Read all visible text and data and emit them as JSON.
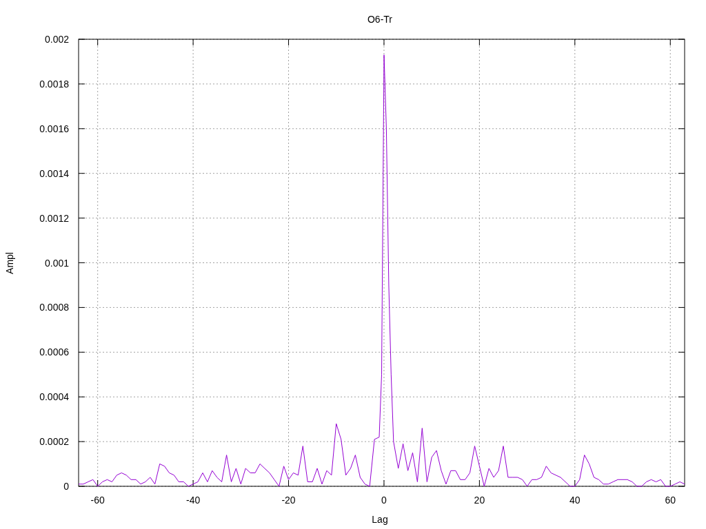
{
  "chart_data": {
    "type": "line",
    "grid": true,
    "title": "O6-Tr",
    "xlabel": "Lag",
    "ylabel": "Ampl",
    "xlim": [
      -64,
      63
    ],
    "ylim": [
      0,
      0.002
    ],
    "xticks": [
      -60,
      -40,
      -20,
      0,
      20,
      40,
      60
    ],
    "yticks": [
      0,
      0.0002,
      0.0004,
      0.0006,
      0.0008,
      0.001,
      0.0012,
      0.0014,
      0.0016,
      0.0018,
      0.002
    ],
    "x": [
      -64,
      -63,
      -62,
      -61,
      -60,
      -59,
      -58,
      -57,
      -56,
      -55,
      -54,
      -53,
      -52,
      -51,
      -50,
      -49,
      -48,
      -47,
      -46,
      -45,
      -44,
      -43,
      -42,
      -41,
      -40,
      -39,
      -38,
      -37,
      -36,
      -35,
      -34,
      -33,
      -32,
      -31,
      -30,
      -29,
      -28,
      -27,
      -26,
      -25,
      -24,
      -23,
      -22,
      -21,
      -20,
      -19,
      -18,
      -17,
      -16,
      -15,
      -14,
      -13,
      -12,
      -11,
      -10,
      -9,
      -8,
      -7,
      -6,
      -5,
      -4,
      -3,
      -2,
      -1,
      -0.5,
      0,
      0.5,
      1,
      1.5,
      2,
      3,
      4,
      5,
      6,
      7,
      8,
      9,
      10,
      11,
      12,
      13,
      14,
      15,
      16,
      17,
      18,
      19,
      20,
      21,
      22,
      23,
      24,
      25,
      26,
      27,
      28,
      29,
      30,
      31,
      32,
      33,
      34,
      35,
      36,
      37,
      38,
      39,
      40,
      41,
      42,
      43,
      44,
      45,
      46,
      47,
      48,
      49,
      50,
      51,
      52,
      53,
      54,
      55,
      56,
      57,
      58,
      59,
      60,
      61,
      62,
      63
    ],
    "series": [
      {
        "color": "#9400d3",
        "values": [
          1e-05,
          1e-05,
          2e-05,
          3e-05,
          0.0,
          2e-05,
          3e-05,
          2e-05,
          5e-05,
          6e-05,
          5e-05,
          3e-05,
          3e-05,
          1e-05,
          2e-05,
          4e-05,
          1e-05,
          0.0001,
          9e-05,
          6e-05,
          5e-05,
          2e-05,
          2e-05,
          0.0,
          1e-05,
          2e-05,
          6e-05,
          2e-05,
          7e-05,
          4e-05,
          2e-05,
          0.00014,
          2e-05,
          8e-05,
          1e-05,
          8e-05,
          6e-05,
          6e-05,
          0.0001,
          8e-05,
          6e-05,
          3e-05,
          0.0,
          9e-05,
          3e-05,
          6e-05,
          5e-05,
          0.00018,
          2e-05,
          2e-05,
          8e-05,
          1e-05,
          7e-05,
          5e-05,
          0.00028,
          0.00021,
          5e-05,
          8e-05,
          0.00014,
          4e-05,
          1e-05,
          0.0,
          0.00021,
          0.00022,
          0.0005,
          0.00193,
          0.0016,
          0.0009,
          0.0005,
          0.0002,
          8e-05,
          0.00019,
          7e-05,
          0.00015,
          2e-05,
          0.00026,
          2e-05,
          0.00013,
          0.00016,
          7e-05,
          1e-05,
          7e-05,
          7e-05,
          3e-05,
          3e-05,
          6e-05,
          0.00018,
          9e-05,
          0.0,
          8e-05,
          4e-05,
          7e-05,
          0.00018,
          4e-05,
          4e-05,
          4e-05,
          3e-05,
          0.0,
          3e-05,
          3e-05,
          4e-05,
          9e-05,
          6e-05,
          5e-05,
          4e-05,
          2e-05,
          0.0,
          0.0,
          3e-05,
          0.00014,
          0.0001,
          4e-05,
          3e-05,
          1e-05,
          1e-05,
          2e-05,
          3e-05,
          3e-05,
          3e-05,
          2e-05,
          0.0,
          0.0,
          2e-05,
          3e-05,
          2e-05,
          3e-05,
          0.0,
          0.0,
          1e-05,
          2e-05,
          1e-05
        ]
      }
    ]
  }
}
